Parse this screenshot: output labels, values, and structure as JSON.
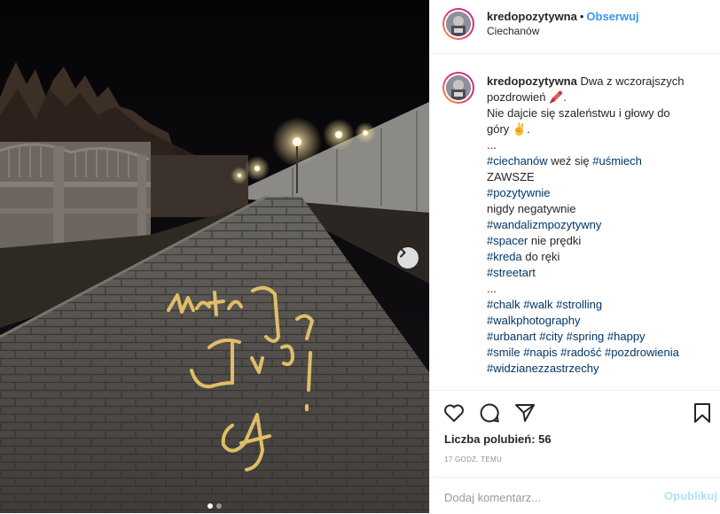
{
  "post": {
    "username": "kredopozytywna",
    "separator": "•",
    "follow_label": "Obserwuj",
    "location": "Ciechanów",
    "caption_lines": [
      [
        {
          "t": "kredopozytywna",
          "k": "user"
        },
        {
          "t": " Dwa z wczorajszych",
          "k": "text"
        }
      ],
      [
        {
          "t": "pozdrowień 🖍️.",
          "k": "text"
        }
      ],
      [
        {
          "t": "Nie dajcie się szaleństwu i głowy do",
          "k": "text"
        }
      ],
      [
        {
          "t": "góry ✌️.",
          "k": "text"
        }
      ],
      [
        {
          "t": "...",
          "k": "text"
        }
      ],
      [
        {
          "t": "#ciechanów",
          "k": "tag"
        },
        {
          "t": " weź się ",
          "k": "text"
        },
        {
          "t": "#uśmiech",
          "k": "tag"
        }
      ],
      [
        {
          "t": "ZAWSZE",
          "k": "text"
        }
      ],
      [
        {
          "t": "#pozytywnie",
          "k": "tag"
        }
      ],
      [
        {
          "t": "nigdy negatywnie",
          "k": "text"
        }
      ],
      [
        {
          "t": "#wandalizmpozytywny",
          "k": "tag"
        }
      ],
      [
        {
          "t": "#spacer",
          "k": "tag"
        },
        {
          "t": " nie prędki",
          "k": "text"
        }
      ],
      [
        {
          "t": "#kreda",
          "k": "tag"
        },
        {
          "t": " do ręki",
          "k": "text"
        }
      ],
      [
        {
          "t": "#streetart",
          "k": "tag"
        }
      ],
      [
        {
          "t": "...",
          "k": "text"
        }
      ],
      [
        {
          "t": "#chalk",
          "k": "tag"
        },
        {
          "t": " ",
          "k": "text"
        },
        {
          "t": "#walk",
          "k": "tag"
        },
        {
          "t": " ",
          "k": "text"
        },
        {
          "t": "#strolling",
          "k": "tag"
        }
      ],
      [
        {
          "t": "#walkphotography",
          "k": "tag"
        }
      ],
      [
        {
          "t": "#urbanart",
          "k": "tag"
        },
        {
          "t": " ",
          "k": "text"
        },
        {
          "t": "#city",
          "k": "tag"
        },
        {
          "t": " ",
          "k": "text"
        },
        {
          "t": "#spring",
          "k": "tag"
        },
        {
          "t": " ",
          "k": "text"
        },
        {
          "t": "#happy",
          "k": "tag"
        }
      ],
      [
        {
          "t": "#smile",
          "k": "tag"
        },
        {
          "t": " ",
          "k": "text"
        },
        {
          "t": "#napis",
          "k": "tag"
        },
        {
          "t": " ",
          "k": "text"
        },
        {
          "t": "#radość",
          "k": "tag"
        },
        {
          "t": " ",
          "k": "text"
        },
        {
          "t": "#pozdrowienia",
          "k": "tag"
        }
      ],
      [
        {
          "t": "#widzianezzastrzechy",
          "k": "tag"
        }
      ]
    ],
    "likes_label": "Liczba polubień: 56",
    "time_ago": "17 GODZ. TEMU",
    "comment_placeholder": "Dodaj komentarz...",
    "publish_label": "Opublikuj",
    "carousel": {
      "count": 2,
      "active": 0
    },
    "icons": [
      "heart-icon",
      "comment-icon",
      "share-icon",
      "bookmark-icon",
      "chevron-right-icon"
    ],
    "colors": {
      "link": "#003569",
      "follow": "#3897f0",
      "publish_disabled": "#b2dffc",
      "chalk": "#e8c46a"
    }
  }
}
